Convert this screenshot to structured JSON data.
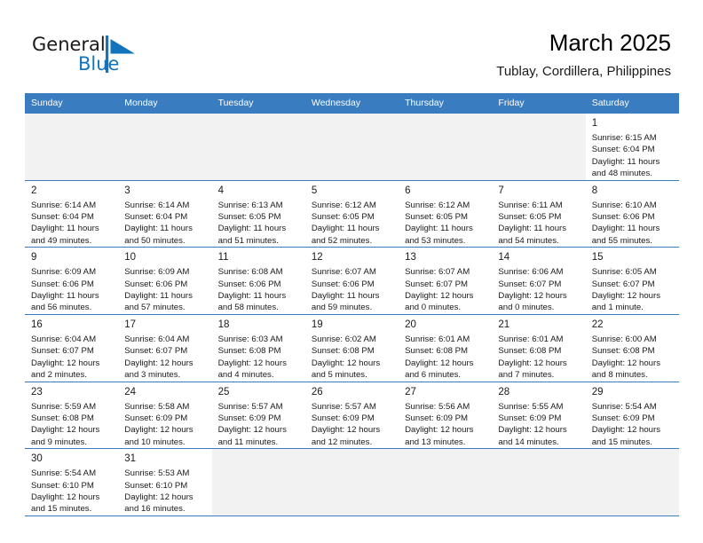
{
  "brand": {
    "name_part1": "General",
    "name_part2": "Blue",
    "mark_icon": "blue-triangle-flag-icon",
    "accent_color": "#1274bc"
  },
  "header": {
    "title": "March 2025",
    "subtitle": "Tublay, Cordillera, Philippines"
  },
  "calendar": {
    "header_bg_color": "#3a7cc0",
    "columns": [
      "Sunday",
      "Monday",
      "Tuesday",
      "Wednesday",
      "Thursday",
      "Friday",
      "Saturday"
    ],
    "weeks": [
      [
        {
          "day": "",
          "info": ""
        },
        {
          "day": "",
          "info": ""
        },
        {
          "day": "",
          "info": ""
        },
        {
          "day": "",
          "info": ""
        },
        {
          "day": "",
          "info": ""
        },
        {
          "day": "",
          "info": ""
        },
        {
          "day": "1",
          "info": "Sunrise: 6:15 AM\nSunset: 6:04 PM\nDaylight: 11 hours\nand 48 minutes."
        }
      ],
      [
        {
          "day": "2",
          "info": "Sunrise: 6:14 AM\nSunset: 6:04 PM\nDaylight: 11 hours\nand 49 minutes."
        },
        {
          "day": "3",
          "info": "Sunrise: 6:14 AM\nSunset: 6:04 PM\nDaylight: 11 hours\nand 50 minutes."
        },
        {
          "day": "4",
          "info": "Sunrise: 6:13 AM\nSunset: 6:05 PM\nDaylight: 11 hours\nand 51 minutes."
        },
        {
          "day": "5",
          "info": "Sunrise: 6:12 AM\nSunset: 6:05 PM\nDaylight: 11 hours\nand 52 minutes."
        },
        {
          "day": "6",
          "info": "Sunrise: 6:12 AM\nSunset: 6:05 PM\nDaylight: 11 hours\nand 53 minutes."
        },
        {
          "day": "7",
          "info": "Sunrise: 6:11 AM\nSunset: 6:05 PM\nDaylight: 11 hours\nand 54 minutes."
        },
        {
          "day": "8",
          "info": "Sunrise: 6:10 AM\nSunset: 6:06 PM\nDaylight: 11 hours\nand 55 minutes."
        }
      ],
      [
        {
          "day": "9",
          "info": "Sunrise: 6:09 AM\nSunset: 6:06 PM\nDaylight: 11 hours\nand 56 minutes."
        },
        {
          "day": "10",
          "info": "Sunrise: 6:09 AM\nSunset: 6:06 PM\nDaylight: 11 hours\nand 57 minutes."
        },
        {
          "day": "11",
          "info": "Sunrise: 6:08 AM\nSunset: 6:06 PM\nDaylight: 11 hours\nand 58 minutes."
        },
        {
          "day": "12",
          "info": "Sunrise: 6:07 AM\nSunset: 6:06 PM\nDaylight: 11 hours\nand 59 minutes."
        },
        {
          "day": "13",
          "info": "Sunrise: 6:07 AM\nSunset: 6:07 PM\nDaylight: 12 hours\nand 0 minutes."
        },
        {
          "day": "14",
          "info": "Sunrise: 6:06 AM\nSunset: 6:07 PM\nDaylight: 12 hours\nand 0 minutes."
        },
        {
          "day": "15",
          "info": "Sunrise: 6:05 AM\nSunset: 6:07 PM\nDaylight: 12 hours\nand 1 minute."
        }
      ],
      [
        {
          "day": "16",
          "info": "Sunrise: 6:04 AM\nSunset: 6:07 PM\nDaylight: 12 hours\nand 2 minutes."
        },
        {
          "day": "17",
          "info": "Sunrise: 6:04 AM\nSunset: 6:07 PM\nDaylight: 12 hours\nand 3 minutes."
        },
        {
          "day": "18",
          "info": "Sunrise: 6:03 AM\nSunset: 6:08 PM\nDaylight: 12 hours\nand 4 minutes."
        },
        {
          "day": "19",
          "info": "Sunrise: 6:02 AM\nSunset: 6:08 PM\nDaylight: 12 hours\nand 5 minutes."
        },
        {
          "day": "20",
          "info": "Sunrise: 6:01 AM\nSunset: 6:08 PM\nDaylight: 12 hours\nand 6 minutes."
        },
        {
          "day": "21",
          "info": "Sunrise: 6:01 AM\nSunset: 6:08 PM\nDaylight: 12 hours\nand 7 minutes."
        },
        {
          "day": "22",
          "info": "Sunrise: 6:00 AM\nSunset: 6:08 PM\nDaylight: 12 hours\nand 8 minutes."
        }
      ],
      [
        {
          "day": "23",
          "info": "Sunrise: 5:59 AM\nSunset: 6:08 PM\nDaylight: 12 hours\nand 9 minutes."
        },
        {
          "day": "24",
          "info": "Sunrise: 5:58 AM\nSunset: 6:09 PM\nDaylight: 12 hours\nand 10 minutes."
        },
        {
          "day": "25",
          "info": "Sunrise: 5:57 AM\nSunset: 6:09 PM\nDaylight: 12 hours\nand 11 minutes."
        },
        {
          "day": "26",
          "info": "Sunrise: 5:57 AM\nSunset: 6:09 PM\nDaylight: 12 hours\nand 12 minutes."
        },
        {
          "day": "27",
          "info": "Sunrise: 5:56 AM\nSunset: 6:09 PM\nDaylight: 12 hours\nand 13 minutes."
        },
        {
          "day": "28",
          "info": "Sunrise: 5:55 AM\nSunset: 6:09 PM\nDaylight: 12 hours\nand 14 minutes."
        },
        {
          "day": "29",
          "info": "Sunrise: 5:54 AM\nSunset: 6:09 PM\nDaylight: 12 hours\nand 15 minutes."
        }
      ],
      [
        {
          "day": "30",
          "info": "Sunrise: 5:54 AM\nSunset: 6:10 PM\nDaylight: 12 hours\nand 15 minutes."
        },
        {
          "day": "31",
          "info": "Sunrise: 5:53 AM\nSunset: 6:10 PM\nDaylight: 12 hours\nand 16 minutes."
        },
        {
          "day": "",
          "info": ""
        },
        {
          "day": "",
          "info": ""
        },
        {
          "day": "",
          "info": ""
        },
        {
          "day": "",
          "info": ""
        },
        {
          "day": "",
          "info": ""
        }
      ]
    ]
  }
}
